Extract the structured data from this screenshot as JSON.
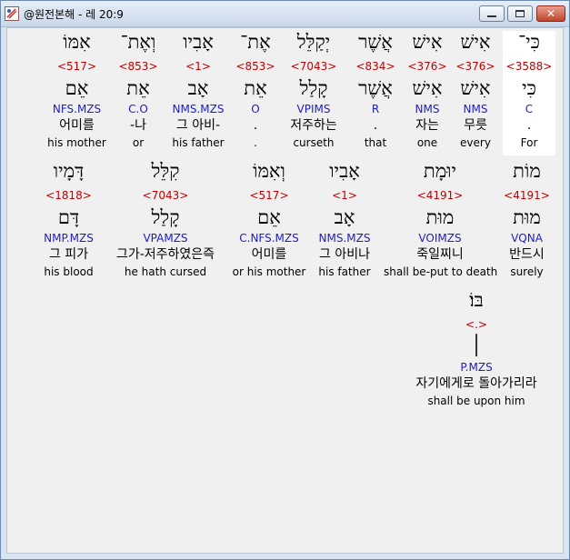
{
  "window": {
    "title": "@원전본해 - 레 20:9",
    "close_glyph": "✕"
  },
  "rows": [
    [
      {
        "hebrew": "כִּי־",
        "strong": "<3588>",
        "lexeme": "כִּי",
        "morph": "C",
        "korean": ".",
        "english": "For",
        "selected": true
      },
      {
        "hebrew": "אִישׁ",
        "strong": "<376>",
        "lexeme": "אִישׁ",
        "morph": "NMS",
        "korean": "무릇",
        "english": "every"
      },
      {
        "hebrew": "אִישׁ",
        "strong": "<376>",
        "lexeme": "אִישׁ",
        "morph": "NMS",
        "korean": "자는",
        "english": "one"
      },
      {
        "hebrew": "אֲשֶׁר",
        "strong": "<834>",
        "lexeme": "אֲשֶׁר",
        "morph": "R",
        "korean": ".",
        "english": "that"
      },
      {
        "hebrew": "יְקַלֵּל",
        "strong": "<7043>",
        "lexeme": "קָלַל",
        "morph": "VPIMS",
        "korean": "저주하는",
        "english": "curseth"
      },
      {
        "hebrew": "אֶת־",
        "strong": "<853>",
        "lexeme": "אֵת",
        "morph": "O",
        "korean": ".",
        "english": "."
      },
      {
        "hebrew": "אָבִיו",
        "strong": "<1>",
        "lexeme": "אָב",
        "morph": "NMS.MZS",
        "korean": "그 아비-",
        "english": "his father"
      },
      {
        "hebrew": "וְאֶת־",
        "strong": "<853>",
        "lexeme": "אֵת",
        "morph": "C.O",
        "korean": "-나",
        "english": "or"
      },
      {
        "hebrew": "אִמּוֹ",
        "strong": "<517>",
        "lexeme": "אֵם",
        "morph": "NFS.MZS",
        "korean": "어미를",
        "english": "his mother"
      }
    ],
    [
      {
        "hebrew": "מוֹת",
        "strong": "<4191>",
        "lexeme": "מוּת",
        "morph": "VQNA",
        "korean": "반드시",
        "english": "surely"
      },
      {
        "hebrew": "יוּמָת",
        "strong": "<4191>",
        "lexeme": "מוּת",
        "morph": "VOIMZS",
        "korean": "죽일찌니",
        "english": "shall be-put to death"
      },
      {
        "hebrew": "אָבִיו",
        "strong": "<1>",
        "lexeme": "אָב",
        "morph": "NMS.MZS",
        "korean": "그 아비나",
        "english": "his father"
      },
      {
        "hebrew": "וְאִמּוֹ",
        "strong": "<517>",
        "lexeme": "אֵם",
        "morph": "C.NFS.MZS",
        "korean": "어미를",
        "english": "or his mother"
      },
      {
        "hebrew": "קִלֵּל",
        "strong": "<7043>",
        "lexeme": "קָלַל",
        "morph": "VPAMZS",
        "korean": "그가-저주하였은즉",
        "english": "he hath cursed"
      },
      {
        "hebrew": "דָּמָיו",
        "strong": "<1818>",
        "lexeme": "דָּם",
        "morph": "NMP.MZS",
        "korean": "그 피가",
        "english": "his blood"
      }
    ],
    [
      {
        "hebrew": "בּוֹ׃",
        "strong": "<.>",
        "lexeme": "׀",
        "morph": "P.MZS",
        "korean": "자기에게로 돌아가리라",
        "english": "shall be upon him"
      }
    ]
  ]
}
